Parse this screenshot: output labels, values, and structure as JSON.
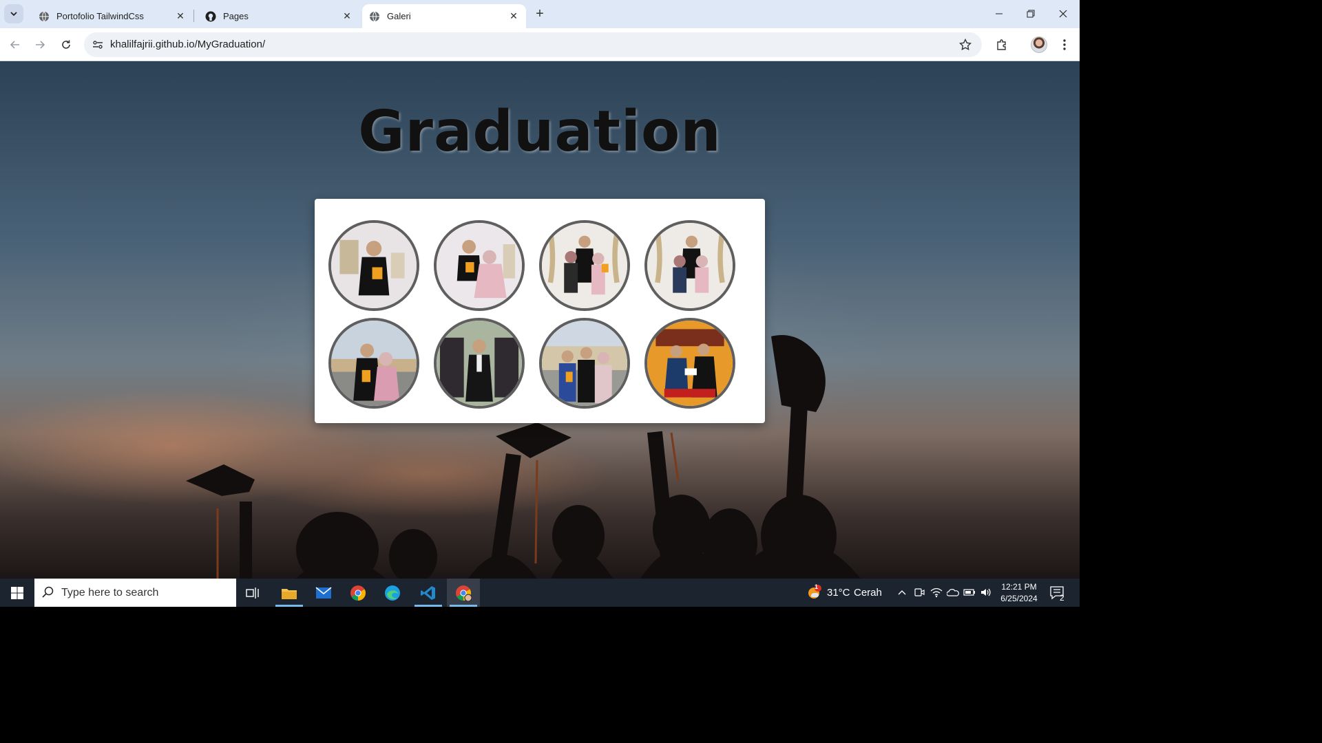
{
  "browser": {
    "tabs": [
      {
        "title": "Portofolio TailwindCss",
        "icon": "globe-icon",
        "active": false
      },
      {
        "title": "Pages",
        "icon": "github-icon",
        "active": false
      },
      {
        "title": "Galeri",
        "icon": "globe-icon",
        "active": true
      }
    ],
    "url": "khalilfajrii.github.io/MyGraduation/"
  },
  "page": {
    "title": "Graduation",
    "gallery": {
      "photos": [
        {
          "description": "graduate-portrait"
        },
        {
          "description": "graduate-with-mother"
        },
        {
          "description": "graduate-with-parents"
        },
        {
          "description": "graduate-with-parents-seated"
        },
        {
          "description": "graduate-with-mother-outdoor"
        },
        {
          "description": "graduate-with-banner"
        },
        {
          "description": "graduate-with-family-outdoor"
        },
        {
          "description": "graduate-receiving-certificate"
        }
      ]
    }
  },
  "taskbar": {
    "search_placeholder": "Type here to search",
    "weather": {
      "temperature": "31°C",
      "condition": "Cerah",
      "badge": "1"
    },
    "clock": {
      "time": "12:21 PM",
      "date": "6/25/2024"
    },
    "notification_count": "2"
  },
  "colors": {
    "gallery_background": "#ffffff",
    "photo_border": "#5f5f5f",
    "tabstrip": "#dfe8f6",
    "taskbar": "#1c2430"
  }
}
